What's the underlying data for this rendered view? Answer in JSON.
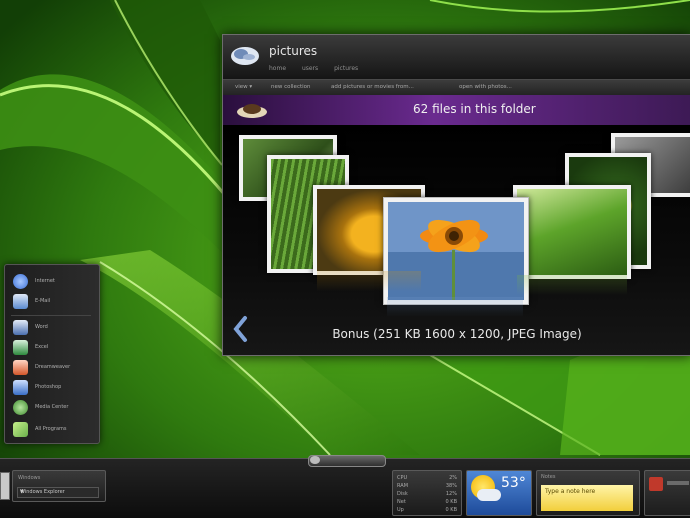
{
  "window": {
    "title": "pictures",
    "breadcrumb": [
      "home",
      "users",
      "pictures"
    ],
    "toolbar": [
      "view ▾",
      "new collection",
      "add pictures or movies from...",
      "open with photos..."
    ],
    "folder_count": "62 files in this folder",
    "caption": "Bonus (251 KB 1600 x 1200, JPEG Image)",
    "back_icon": "chevron-left-icon"
  },
  "startmenu": {
    "items": [
      {
        "label": "Internet",
        "icon": "globe-icon",
        "color": "#3b6fd6"
      },
      {
        "label": "E-Mail",
        "icon": "mail-icon",
        "color": "#5a8ad0"
      },
      {
        "label": "Word",
        "icon": "document-icon",
        "color": "#4a6fb0"
      },
      {
        "label": "Excel",
        "icon": "spreadsheet-icon",
        "color": "#2e8b3e"
      },
      {
        "label": "Dreamweaver",
        "icon": "paint-icon",
        "color": "#d4572a"
      },
      {
        "label": "Photoshop",
        "icon": "people-icon",
        "color": "#3a6fc8"
      },
      {
        "label": "Media Center",
        "icon": "media-icon",
        "color": "#3e8a2e"
      },
      {
        "label": "All Programs",
        "icon": "arrow-icon",
        "color": "#6ab04c"
      }
    ]
  },
  "taskbar": {
    "task_title": "Windows",
    "combo_value": "Windows Explorer"
  },
  "gadgets": {
    "stats": [
      {
        "k": "CPU",
        "v": "2%"
      },
      {
        "k": "RAM",
        "v": "38%"
      },
      {
        "k": "Disk",
        "v": "12%"
      },
      {
        "k": "Net",
        "v": "0 KB"
      },
      {
        "k": "Up",
        "v": "0 KB"
      }
    ],
    "weather_temp": "53°",
    "note_head": "Notes",
    "note_text": "Type a note here",
    "colors": {
      "sun": "#f3b400",
      "note": "#f2cf3c",
      "accent": "#6a2a8f"
    }
  }
}
